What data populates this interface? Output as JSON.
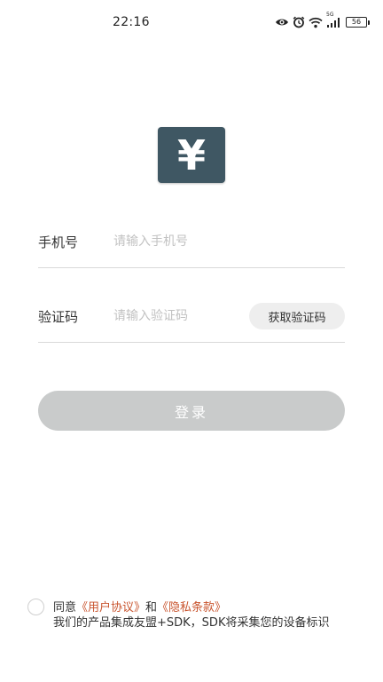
{
  "status_bar": {
    "time": "22:16",
    "network_label": "5G",
    "battery": "56"
  },
  "logo": {
    "glyph": "¥",
    "color": "#3f5763"
  },
  "form": {
    "phone": {
      "label": "手机号",
      "placeholder": "请输入手机号",
      "value": ""
    },
    "code": {
      "label": "验证码",
      "placeholder": "请输入验证码",
      "value": "",
      "button_label": "获取验证码"
    },
    "login_label": "登录"
  },
  "agreement": {
    "checked": false,
    "prefix": "同意",
    "user_agreement": "《用户协议》",
    "conjunction": "和",
    "privacy_terms": "《隐私条款》",
    "sdk_notice": "我们的产品集成友盟+SDK，SDK将采集您的设备标识"
  },
  "colors": {
    "link": "#c9552f",
    "login_disabled": "#c9cbcb",
    "code_button_bg": "#eeeeee"
  }
}
